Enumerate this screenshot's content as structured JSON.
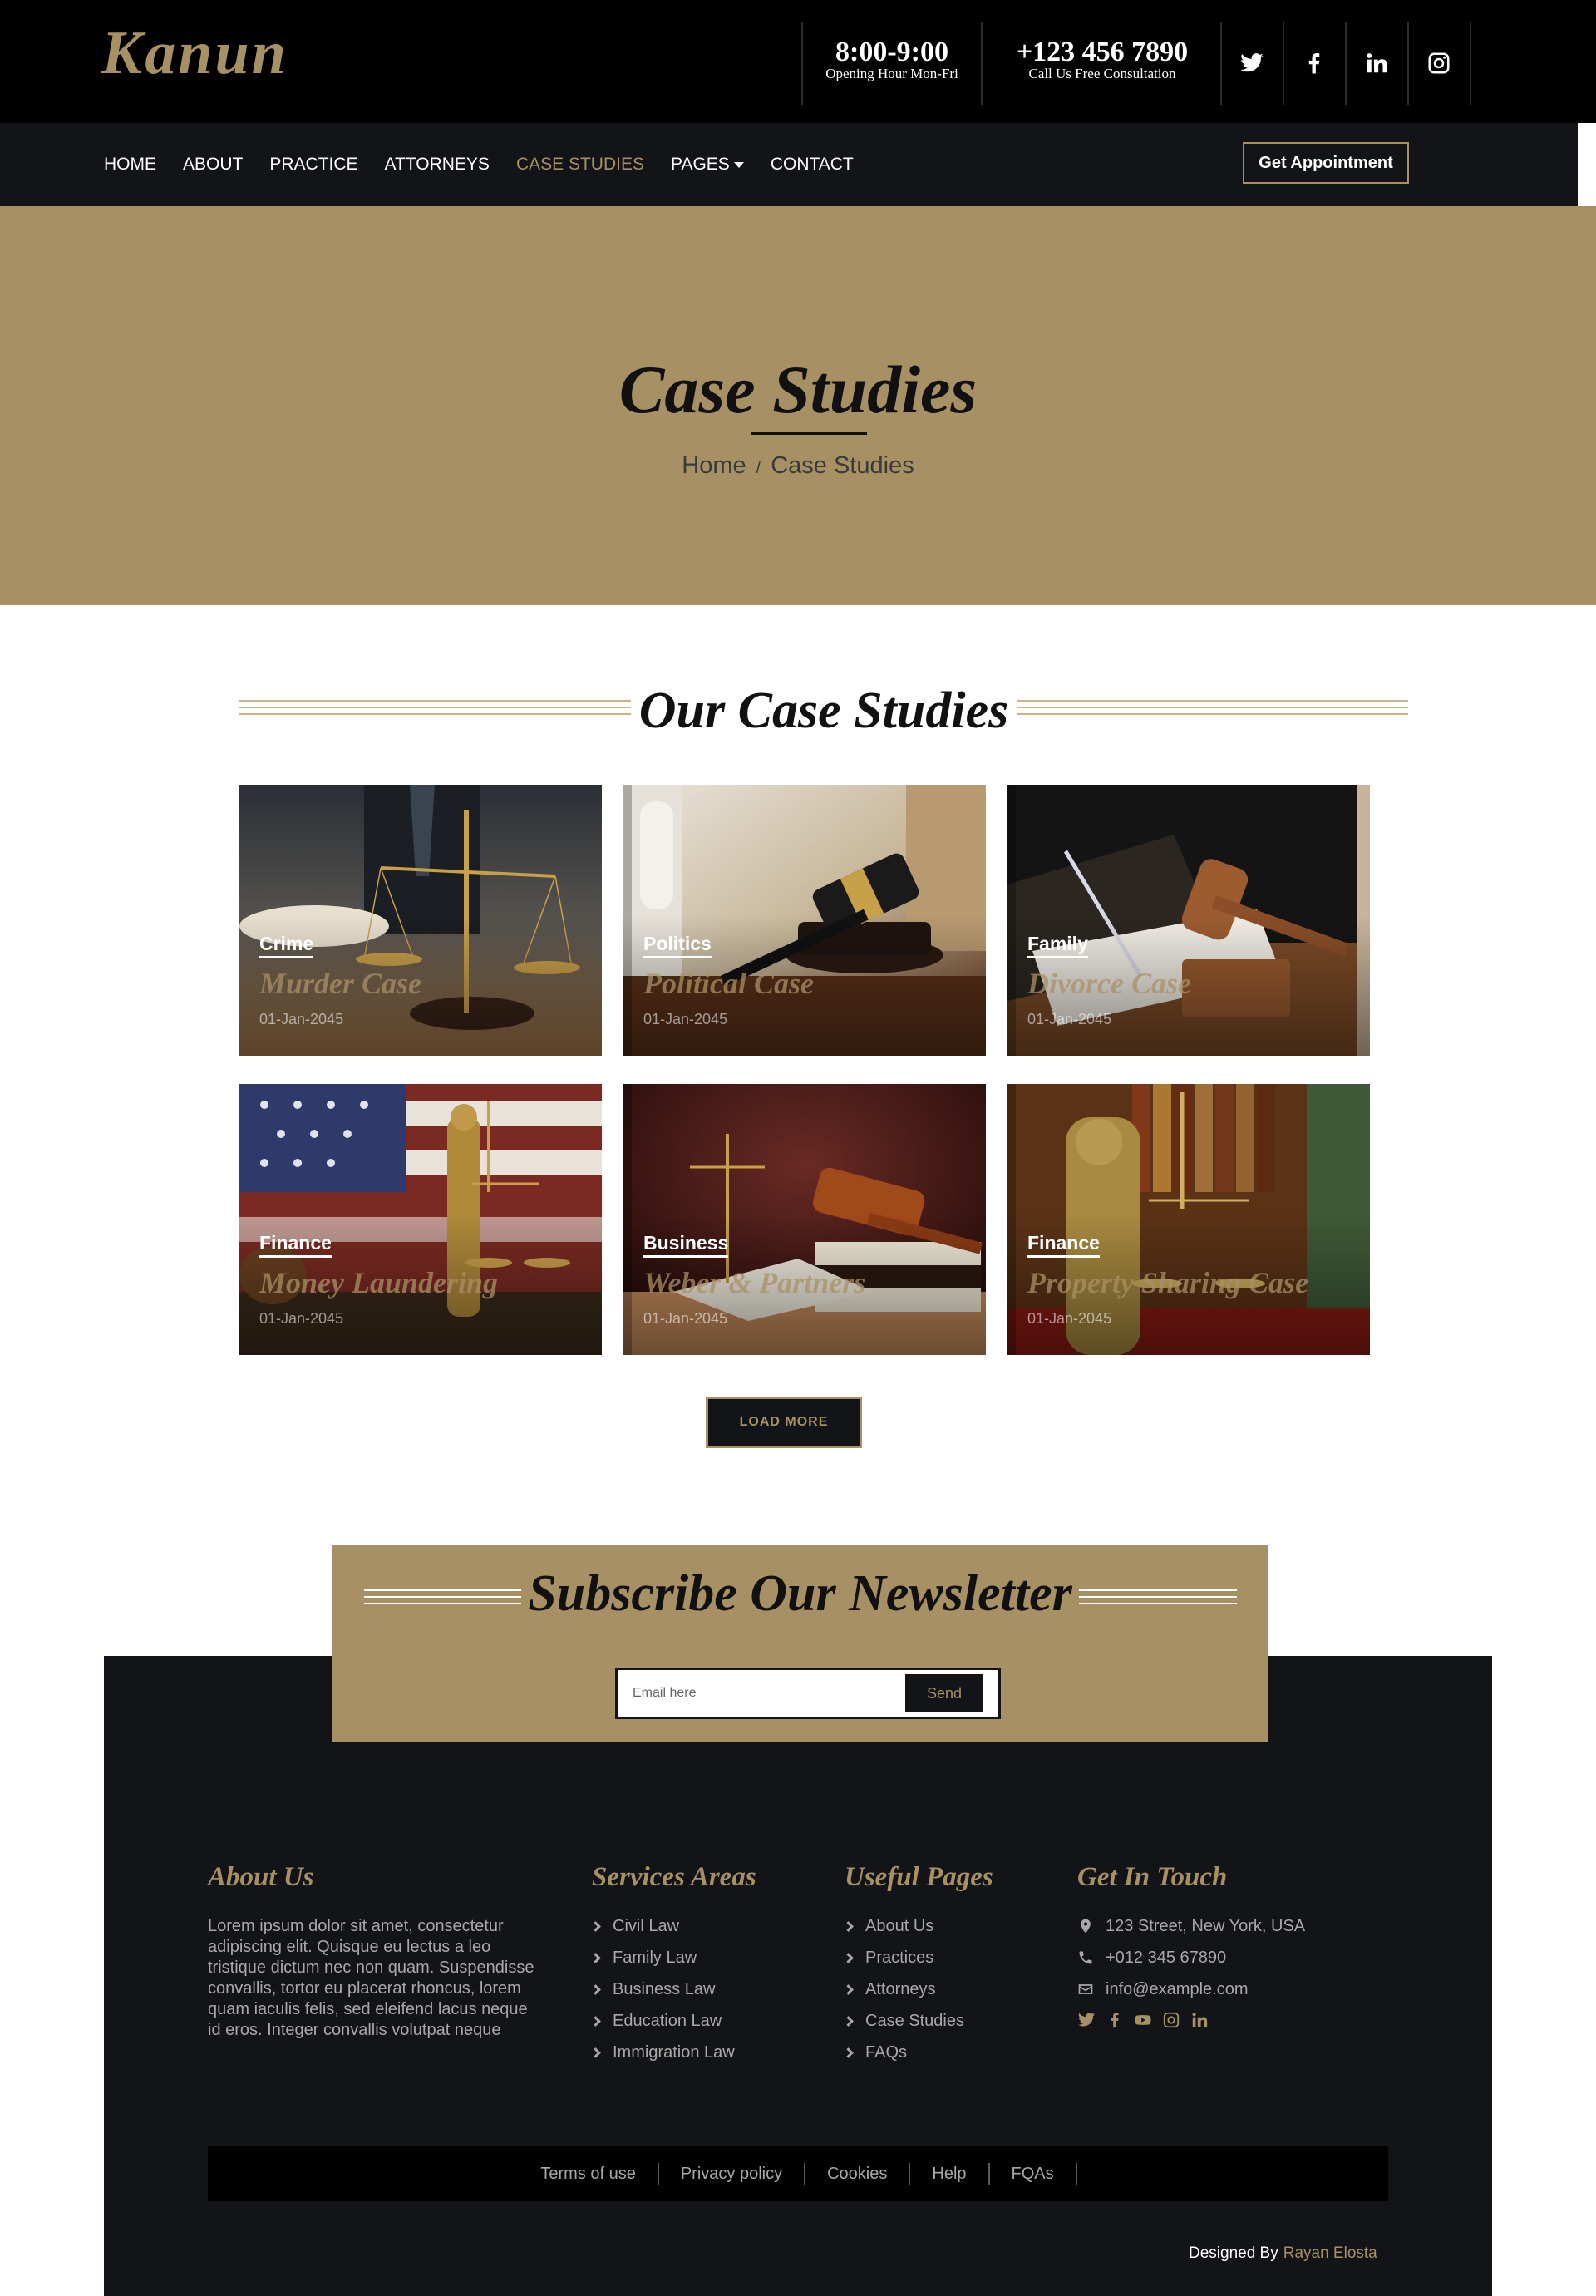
{
  "brand": {
    "logo": "Kanun"
  },
  "topbar": {
    "hours": {
      "value": "8:00-9:00",
      "caption": "Opening Hour Mon-Fri"
    },
    "phone": {
      "value": "+123 456 7890",
      "caption": "Call Us Free Consultation"
    },
    "social": [
      "twitter-icon",
      "facebook-icon",
      "linkedin-icon",
      "instagram-icon"
    ]
  },
  "nav": {
    "items": [
      "HOME",
      "ABOUT",
      "PRACTICE",
      "ATTORNEYS",
      "CASE STUDIES",
      "PAGES",
      "CONTACT"
    ],
    "active": "CASE STUDIES",
    "cta": "Get Appointment"
  },
  "hero": {
    "title": "Case Studies",
    "breadcrumb": [
      "Home",
      "Case Studies"
    ],
    "separator": "/"
  },
  "section": {
    "title": "Our Case Studies"
  },
  "cases": [
    {
      "category": "Crime",
      "title": "Murder Case",
      "date": "01-Jan-2045"
    },
    {
      "category": "Politics",
      "title": "Political Case",
      "date": "01-Jan-2045"
    },
    {
      "category": "Family",
      "title": "Divorce Case",
      "date": "01-Jan-2045"
    },
    {
      "category": "Finance",
      "title": "Money Laundering",
      "date": "01-Jan-2045"
    },
    {
      "category": "Business",
      "title": "Weber & Partners",
      "date": "01-Jan-2045"
    },
    {
      "category": "Finance",
      "title": "Property Sharing Case",
      "date": "01-Jan-2045"
    }
  ],
  "load_more": "LOAD MORE",
  "newsletter": {
    "title": "Subscribe Our Newsletter",
    "placeholder": "Email here",
    "button": "Send"
  },
  "footer": {
    "about": {
      "heading": "About Us",
      "text": "Lorem ipsum dolor sit amet, consectetur adipiscing elit. Quisque eu lectus a leo tristique dictum nec non quam. Suspendisse convallis, tortor eu placerat rhoncus, lorem quam iaculis felis, sed eleifend lacus neque id eros. Integer convallis volutpat neque"
    },
    "services": {
      "heading": "Services Areas",
      "links": [
        "Civil Law",
        "Family Law",
        "Business Law",
        "Education Law",
        "Immigration Law"
      ]
    },
    "pages": {
      "heading": "Useful Pages",
      "links": [
        "About Us",
        "Practices",
        "Attorneys",
        "Case Studies",
        "FAQs"
      ]
    },
    "contact": {
      "heading": "Get In Touch",
      "address": "123 Street, New York, USA",
      "phone": "+012 345 67890",
      "email": "info@example.com",
      "social": [
        "twitter-icon",
        "facebook-icon",
        "youtube-icon",
        "instagram-icon",
        "linkedin-icon"
      ]
    },
    "bottom_links": [
      "Terms of use",
      "Privacy policy",
      "Cookies",
      "Help",
      "FQAs"
    ],
    "credit": {
      "label": "Designed By",
      "author": "Rayan Elosta"
    }
  },
  "colors": {
    "accent": "#a89065",
    "dark": "#121417",
    "black": "#000000"
  }
}
